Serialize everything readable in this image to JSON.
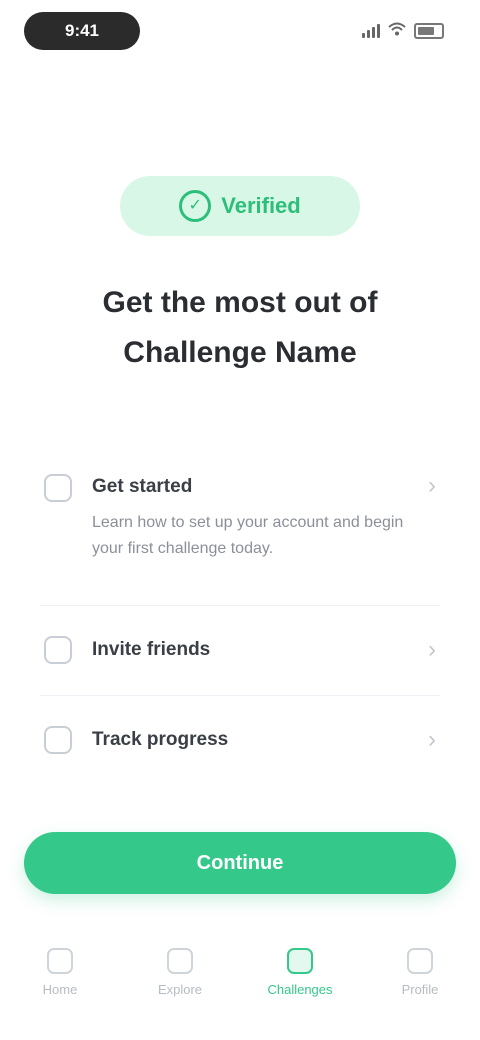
{
  "status_bar": {
    "time": "9:41"
  },
  "hero": {
    "badge_label": "Verified",
    "headline": "Get the most out of Challenge Name"
  },
  "list": {
    "items": [
      {
        "title": "Get started",
        "description": "Learn how to set up your account and begin your first challenge today.",
        "icon": "info-icon"
      },
      {
        "title": "Invite friends",
        "icon": "users-icon"
      },
      {
        "title": "Track progress",
        "icon": "chart-icon"
      }
    ]
  },
  "cta": {
    "label": "Continue"
  },
  "tabbar": {
    "tabs": [
      {
        "label": "Home",
        "icon": "home-icon"
      },
      {
        "label": "Explore",
        "icon": "explore-icon"
      },
      {
        "label": "Challenges",
        "icon": "challenges-icon"
      },
      {
        "label": "Profile",
        "icon": "profile-icon"
      }
    ],
    "active_index": 2
  },
  "colors": {
    "accent": "#34c98a",
    "badge_bg": "#d9f7e7",
    "status_pill": "#2b2b2b"
  }
}
